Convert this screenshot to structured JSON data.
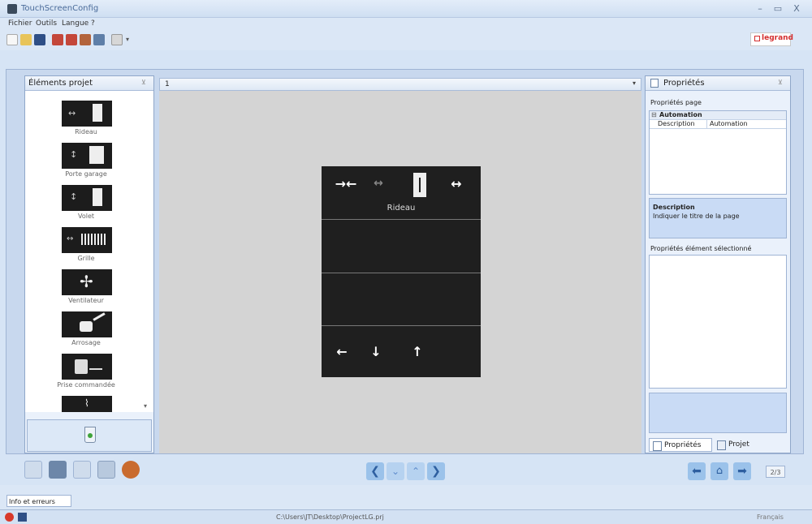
{
  "window": {
    "title": "TouchScreenConfig",
    "minimize": "–",
    "maximize": "▭",
    "close": "X"
  },
  "menu": [
    "Fichier",
    "Outils",
    "Langue",
    "?"
  ],
  "brand": {
    "name": "legrand",
    "color": "#d42e2e"
  },
  "left_panel": {
    "title": "Éléments projet",
    "items": [
      {
        "label": "Rideau",
        "icon": "curtain-icon"
      },
      {
        "label": "Porte garage",
        "icon": "garage-door-icon"
      },
      {
        "label": "Volet",
        "icon": "shutter-icon"
      },
      {
        "label": "Grille",
        "icon": "grille-icon"
      },
      {
        "label": "Ventilateur",
        "icon": "fan-icon"
      },
      {
        "label": "Arrosage",
        "icon": "watering-can-icon"
      },
      {
        "label": "Prise commandée",
        "icon": "controlled-socket-icon"
      }
    ]
  },
  "center": {
    "tab": "1",
    "device": {
      "title": "Rideau",
      "top_buttons": [
        "→←",
        "↔",
        "↔"
      ],
      "bottom_buttons": [
        "←",
        "↓",
        "↑"
      ]
    }
  },
  "right_panel": {
    "title": "Propriétés",
    "page_props_label": "Propriétés page",
    "group": "Automation",
    "row_key": "Description",
    "row_value": "Automation",
    "desc_title": "Description",
    "desc_text": "Indiquer le titre de la page",
    "element_props_label": "Propriétés élément sélectionné",
    "tab_props": "Propriétés",
    "tab_project": "Projet"
  },
  "nav": {
    "page_counter": "2/3"
  },
  "bottom_tab": "Info et erreurs",
  "status": {
    "path": "C:\\Users\\JT\\Desktop\\ProjectLG.prj",
    "language": "Français"
  }
}
